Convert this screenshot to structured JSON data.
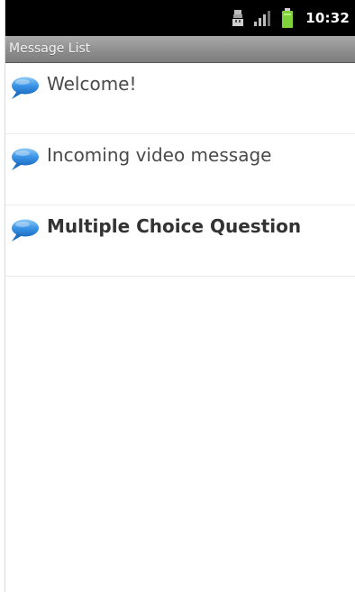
{
  "status_bar": {
    "time": "10:32",
    "icons": [
      "usb-icon",
      "signal-icon",
      "battery-icon"
    ],
    "background": "#000000",
    "battery_color": "#7fd13b"
  },
  "header": {
    "title": "Message List"
  },
  "messages": [
    {
      "label": "Welcome!",
      "icon": "speech-bubble-icon",
      "bold": false
    },
    {
      "label": "Incoming video message",
      "icon": "speech-bubble-icon",
      "bold": false
    },
    {
      "label": "Multiple Choice Question",
      "icon": "speech-bubble-icon",
      "bold": true
    }
  ],
  "colors": {
    "bubble": "#2f8be0",
    "title_bar": "#8f8f8f"
  }
}
